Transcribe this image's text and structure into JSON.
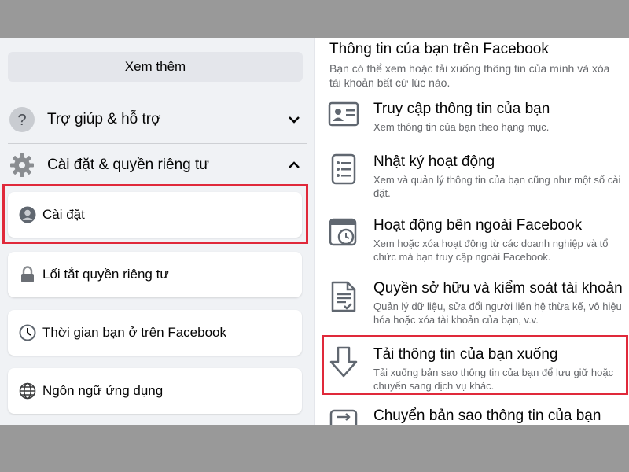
{
  "left": {
    "see_more": "Xem thêm",
    "help": {
      "label": "Trợ giúp & hỗ trợ",
      "icon": "question-circle-icon"
    },
    "settings_privacy": {
      "label": "Cài đặt & quyền riêng tư",
      "icon": "gear-icon"
    },
    "items": [
      {
        "label": "Cài đặt",
        "icon": "profile-icon"
      },
      {
        "label": "Lối tắt quyền riêng tư",
        "icon": "lock-icon"
      },
      {
        "label": "Thời gian bạn ở trên Facebook",
        "icon": "clock-icon"
      },
      {
        "label": "Ngôn ngữ ứng dụng",
        "icon": "globe-icon"
      }
    ]
  },
  "right": {
    "heading": "Thông tin của bạn trên Facebook",
    "intro": "Bạn có thể xem hoặc tải xuống thông tin của mình và xóa tài khoản bất cứ lúc nào.",
    "items": [
      {
        "title": "Truy cập thông tin của bạn",
        "desc": "Xem thông tin của bạn theo hạng mục.",
        "icon": "id-card-icon"
      },
      {
        "title": "Nhật ký hoạt động",
        "desc": "Xem và quản lý thông tin của bạn cũng như một số cài đặt.",
        "icon": "list-icon"
      },
      {
        "title": "Hoạt động bên ngoài Facebook",
        "desc": "Xem hoặc xóa hoạt động từ các doanh nghiệp và tổ chức mà bạn truy cập ngoài Facebook.",
        "icon": "history-icon"
      },
      {
        "title": "Quyền sở hữu và kiểm soát tài khoản",
        "desc": "Quản lý dữ liệu, sửa đổi người liên hệ thừa kế, vô hiệu hóa hoặc xóa tài khoản của bạn, v.v.",
        "icon": "document-icon"
      },
      {
        "title": "Tải thông tin của bạn xuống",
        "desc": "Tải xuống bản sao thông tin của bạn để lưu giữ hoặc chuyển sang dịch vụ khác.",
        "icon": "download-arrow-icon"
      },
      {
        "title": "Chuyển bản sao thông tin của bạn",
        "desc": "",
        "icon": "transfer-icon"
      }
    ]
  },
  "colors": {
    "highlight": "#e0293a",
    "panel_bg": "#f0f2f5",
    "muted_text": "#65676b"
  }
}
